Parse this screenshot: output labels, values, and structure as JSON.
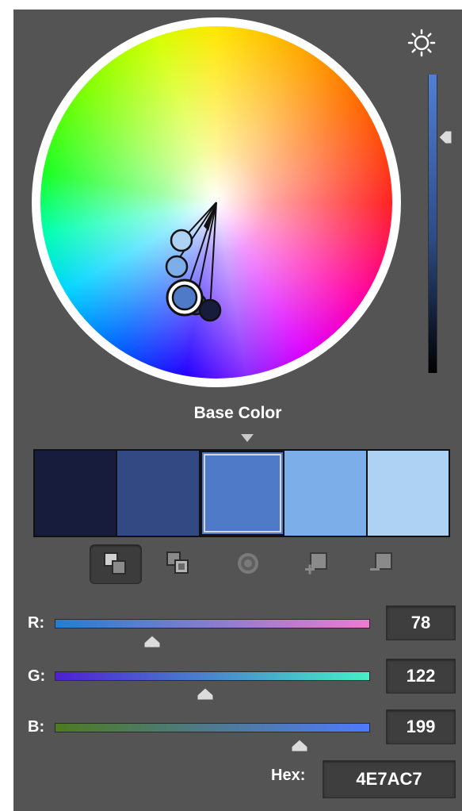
{
  "base_color_label": "Base Color",
  "swatches": [
    {
      "name": "swatch-1",
      "color": "#171b3c"
    },
    {
      "name": "swatch-2",
      "color": "#334983"
    },
    {
      "name": "swatch-3",
      "color": "#4e7ac7",
      "selected": true
    },
    {
      "name": "swatch-4",
      "color": "#7caee9"
    },
    {
      "name": "swatch-5",
      "color": "#aed2f3"
    }
  ],
  "mode_buttons": [
    {
      "name": "set-base-color-mode-button",
      "active": true
    },
    {
      "name": "layer-swap-mode-button",
      "active": false
    },
    {
      "name": "target-mode-button",
      "active": false
    },
    {
      "name": "add-color-button",
      "active": false
    },
    {
      "name": "remove-color-button",
      "active": false
    }
  ],
  "brightness": {
    "level_fraction": 0.21
  },
  "channels": {
    "r": {
      "label": "R:",
      "value": "78",
      "level_fraction": 0.31,
      "gradient": [
        "#1f7fd2",
        "#f07ad0"
      ]
    },
    "g": {
      "label": "G:",
      "value": "122",
      "level_fraction": 0.48,
      "gradient": [
        "#4e1fd2",
        "#45f0c7"
      ]
    },
    "b": {
      "label": "B:",
      "value": "199",
      "level_fraction": 0.78,
      "gradient": [
        "#4e7a20",
        "#4e7aff"
      ]
    }
  },
  "hex": {
    "label": "Hex:",
    "value": "4E7AC7"
  }
}
